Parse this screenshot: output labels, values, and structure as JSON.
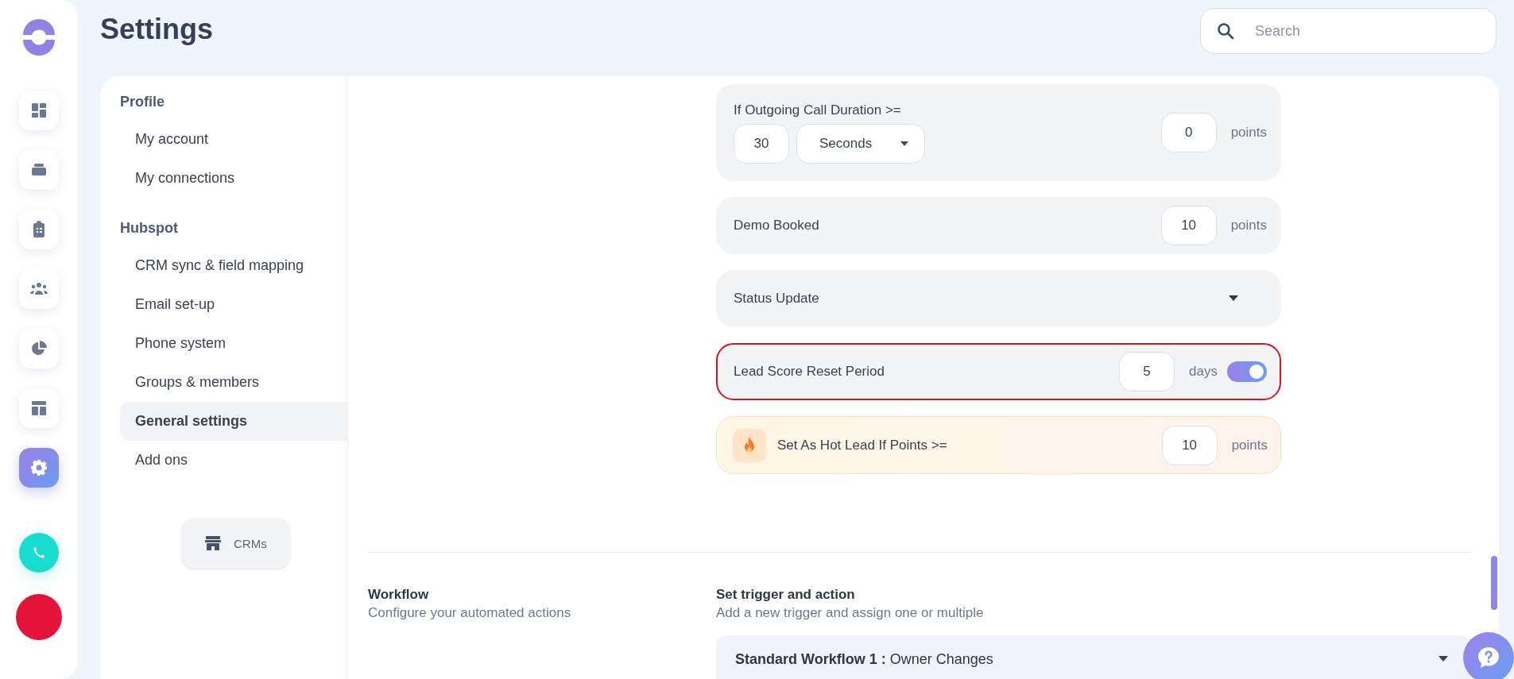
{
  "rail": [
    {
      "kind": "dashboard",
      "selected": false
    },
    {
      "kind": "stack",
      "selected": false
    },
    {
      "kind": "clipboard",
      "selected": false
    },
    {
      "kind": "people",
      "selected": false
    },
    {
      "kind": "pie",
      "selected": false
    },
    {
      "kind": "layout",
      "selected": false
    },
    {
      "kind": "gear",
      "selected": true
    }
  ],
  "page_title": "Settings",
  "search": {
    "placeholder": "Search"
  },
  "settings_nav": [
    {
      "heading": "Profile",
      "items": [
        {
          "label": "My account",
          "selected": false
        },
        {
          "label": "My connections",
          "selected": false
        }
      ]
    },
    {
      "heading": "Hubspot",
      "items": [
        {
          "label": "CRM sync & field mapping",
          "selected": false
        },
        {
          "label": "Email set-up",
          "selected": false
        },
        {
          "label": "Phone system",
          "selected": false
        },
        {
          "label": "Groups & members",
          "selected": false
        },
        {
          "label": "General settings",
          "selected": true
        },
        {
          "label": "Add ons",
          "selected": false
        }
      ]
    }
  ],
  "crms_button": "CRMs",
  "scoring_rules": [
    {
      "kind": "duration",
      "label": "If Outgoing Call Duration >=",
      "value": "30",
      "unit": "Seconds",
      "points": "0",
      "points_label": "points",
      "highlighted": false
    },
    {
      "kind": "points",
      "label": "Demo Booked",
      "points": "10",
      "points_label": "points",
      "highlighted": false
    },
    {
      "kind": "dropdown",
      "label": "Status Update",
      "highlighted": false
    },
    {
      "kind": "toggle",
      "label": "Lead Score Reset Period",
      "value": "5",
      "unit": "days",
      "on": true,
      "highlighted": true
    },
    {
      "kind": "hot",
      "label": "Set As Hot Lead If Points >=",
      "points": "10",
      "points_label": "points",
      "highlighted": false
    }
  ],
  "workflow_section": {
    "title": "Workflow",
    "subtitle": "Configure your automated actions"
  },
  "trigger_section": {
    "title": "Set trigger and action",
    "subtitle": "Add a new trigger and assign one or multiple"
  },
  "workflows": [
    {
      "name": "Standard Workflow 1 :",
      "trigger": "Owner Changes"
    }
  ]
}
